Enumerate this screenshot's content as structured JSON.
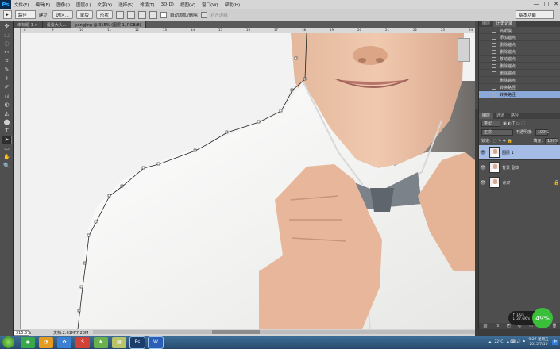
{
  "app": {
    "logo": "Ps",
    "menu": [
      "文件(F)",
      "编辑(E)",
      "图像(I)",
      "图层(L)",
      "文字(Y)",
      "选择(S)",
      "滤镜(T)",
      "3D(D)",
      "视图(V)",
      "窗口(W)",
      "帮助(H)"
    ],
    "window_controls": [
      "—",
      "□",
      "✕"
    ]
  },
  "options_bar": {
    "tool_preset": "▸",
    "mode": "路径",
    "make_label": "建立:",
    "selection_btn": "选区...",
    "mask_btn": "蒙版",
    "shape_btn": "形状",
    "auto_add_delete": "自动添加/删除",
    "align_edges": "对齐边缘",
    "workspace": "基本功能"
  },
  "tabs": [
    {
      "label": "未标题-1 ×",
      "active": false
    },
    {
      "label": "蛋蛋大头...",
      "active": false
    },
    {
      "label": "yangjing @ 315% (图层 1, RGB/8)",
      "active": true
    }
  ],
  "tools": [
    "✥",
    "⬚",
    "◌",
    "✂",
    "⌗",
    "✎",
    "⚕",
    "✐",
    "⎌",
    "◐",
    "◭",
    "⬤",
    "T",
    "➤",
    "▭",
    "✋",
    "🔍"
  ],
  "ruler_ticks": [
    "8",
    "9",
    "10",
    "11",
    "12",
    "13",
    "14",
    "15",
    "16",
    "17",
    "18",
    "19",
    "20",
    "21",
    "22",
    "23",
    "24"
  ],
  "status": {
    "zoom": "315.5%",
    "doc": "文档:2.61M/7.28M"
  },
  "history": {
    "tabs": [
      "图层",
      "历史记录"
    ],
    "rows": [
      "高斯模",
      "添加锚点",
      "删除锚点",
      "删除锚点",
      "移动锚点",
      "删除锚点",
      "删除锚点",
      "删除锚点",
      "转换路径",
      "转换路径"
    ],
    "active_index": 9
  },
  "layers_panel": {
    "tabs": [
      "图层",
      "通道",
      "路径"
    ],
    "filter": "类型",
    "blend_mode": "正常",
    "opacity_label": "不透明度:",
    "opacity": "100%",
    "lock_label": "锁定:",
    "fill_label": "填充:",
    "fill": "100%",
    "layers": [
      {
        "name": "图层 1",
        "active": true,
        "locked": false
      },
      {
        "name": "背景 副本",
        "active": false,
        "locked": false
      },
      {
        "name": "背景",
        "active": false,
        "locked": true
      }
    ],
    "bottom_icons": [
      "⛓",
      "fx",
      "◩",
      "◐",
      "▭",
      "▣",
      "🗑"
    ]
  },
  "cpu_widget": {
    "up": "↑ 1K/s",
    "down": "↓ 27.6K/s",
    "value": "49%"
  },
  "taskbar": {
    "apps": [
      {
        "label": "◉",
        "color": "#39a84a",
        "active": false
      },
      {
        "label": "◔",
        "color": "#e59b22",
        "active": false
      },
      {
        "label": "✿",
        "color": "#3d7fd0",
        "active": false
      },
      {
        "label": "S",
        "color": "#d04237",
        "active": false
      },
      {
        "label": "♞",
        "color": "#6ab04c",
        "active": false
      },
      {
        "label": "▤",
        "color": "#b9c46a",
        "active": false
      },
      {
        "label": "Ps",
        "color": "#1b3d6b",
        "active": true
      },
      {
        "label": "W",
        "color": "#2b5fb7",
        "active": true
      }
    ],
    "weather": "22°C",
    "time": "9:27 星期五",
    "date": "2015/7/10",
    "lang": "中"
  }
}
